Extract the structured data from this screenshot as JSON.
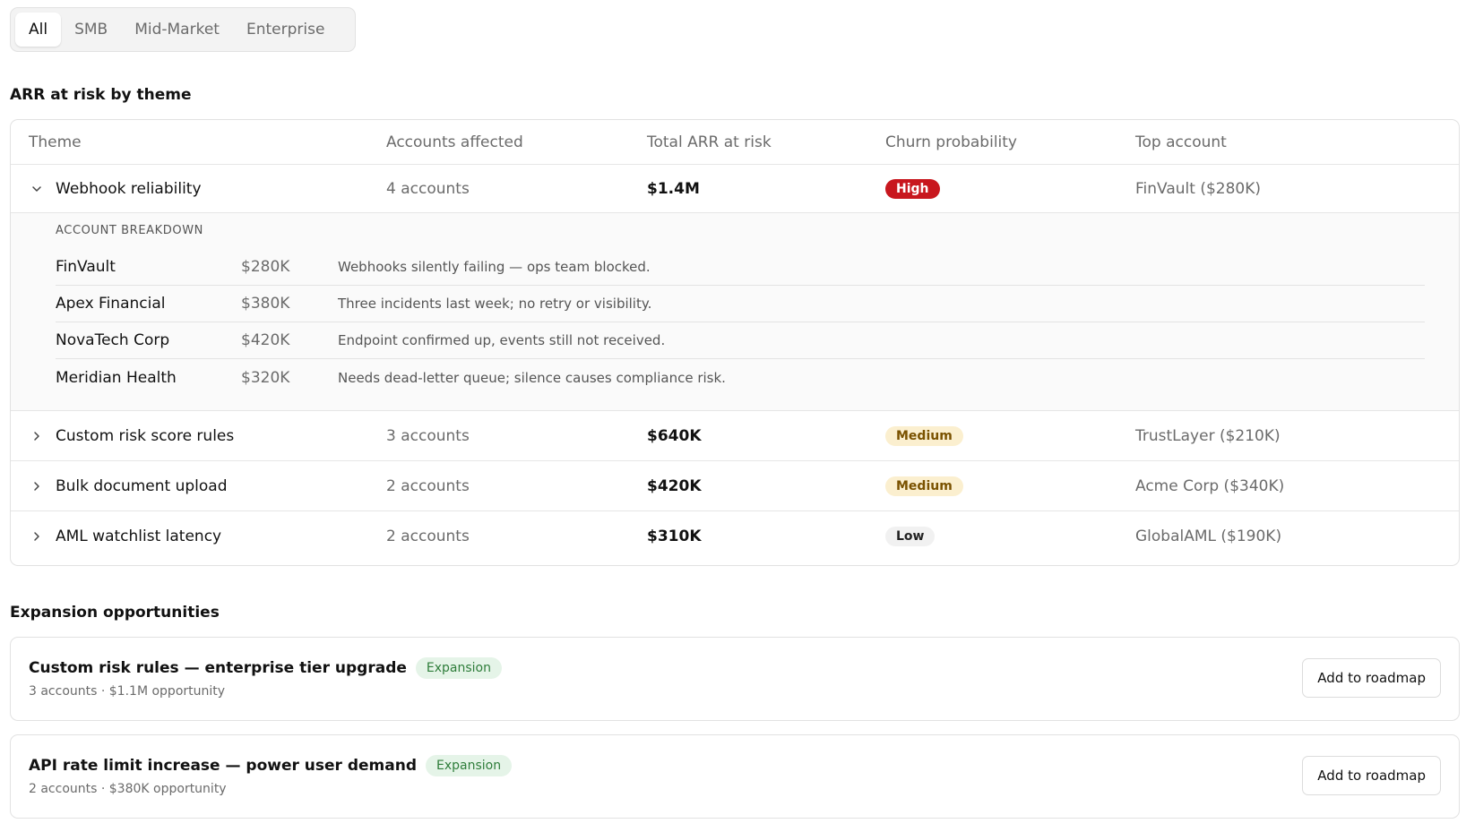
{
  "tabs": [
    {
      "label": "All",
      "active": true
    },
    {
      "label": "SMB",
      "active": false
    },
    {
      "label": "Mid-Market",
      "active": false
    },
    {
      "label": "Enterprise",
      "active": false
    }
  ],
  "arr_section": {
    "title": "ARR at risk by theme",
    "columns": [
      "Theme",
      "Accounts affected",
      "Total ARR at risk",
      "Churn probability",
      "Top account"
    ],
    "rows": [
      {
        "theme": "Webhook reliability",
        "accounts": "4 accounts",
        "arr": "$1.4M",
        "churn": "High",
        "top": "FinVault ($280K)",
        "expanded": true
      },
      {
        "theme": "Custom risk score rules",
        "accounts": "3 accounts",
        "arr": "$640K",
        "churn": "Medium",
        "top": "TrustLayer ($210K)",
        "expanded": false
      },
      {
        "theme": "Bulk document upload",
        "accounts": "2 accounts",
        "arr": "$420K",
        "churn": "Medium",
        "top": "Acme Corp ($340K)",
        "expanded": false
      },
      {
        "theme": "AML watchlist latency",
        "accounts": "2 accounts",
        "arr": "$310K",
        "churn": "Low",
        "top": "GlobalAML ($190K)",
        "expanded": false
      }
    ],
    "breakdown": {
      "title": "ACCOUNT BREAKDOWN",
      "items": [
        {
          "name": "FinVault",
          "amount": "$280K",
          "note": "Webhooks silently failing — ops team blocked."
        },
        {
          "name": "Apex Financial",
          "amount": "$380K",
          "note": "Three incidents last week; no retry or visibility."
        },
        {
          "name": "NovaTech Corp",
          "amount": "$420K",
          "note": "Endpoint confirmed up, events still not received."
        },
        {
          "name": "Meridian Health",
          "amount": "$320K",
          "note": "Needs dead-letter queue; silence causes compliance risk."
        }
      ]
    }
  },
  "expansion": {
    "title": "Expansion opportunities",
    "cards": [
      {
        "title": "Custom risk rules — enterprise tier upgrade",
        "badge": "Expansion",
        "subtitle": "3 accounts · $1.1M opportunity",
        "button": "Add to roadmap"
      },
      {
        "title": "API rate limit increase — power user demand",
        "badge": "Expansion",
        "subtitle": "2 accounts · $380K opportunity",
        "button": "Add to roadmap"
      }
    ]
  },
  "colors": {
    "high": "#c8171e",
    "medium_bg": "#fbefcf",
    "low_bg": "#f1f1f1",
    "expansion_bg": "#e5f4e8"
  }
}
